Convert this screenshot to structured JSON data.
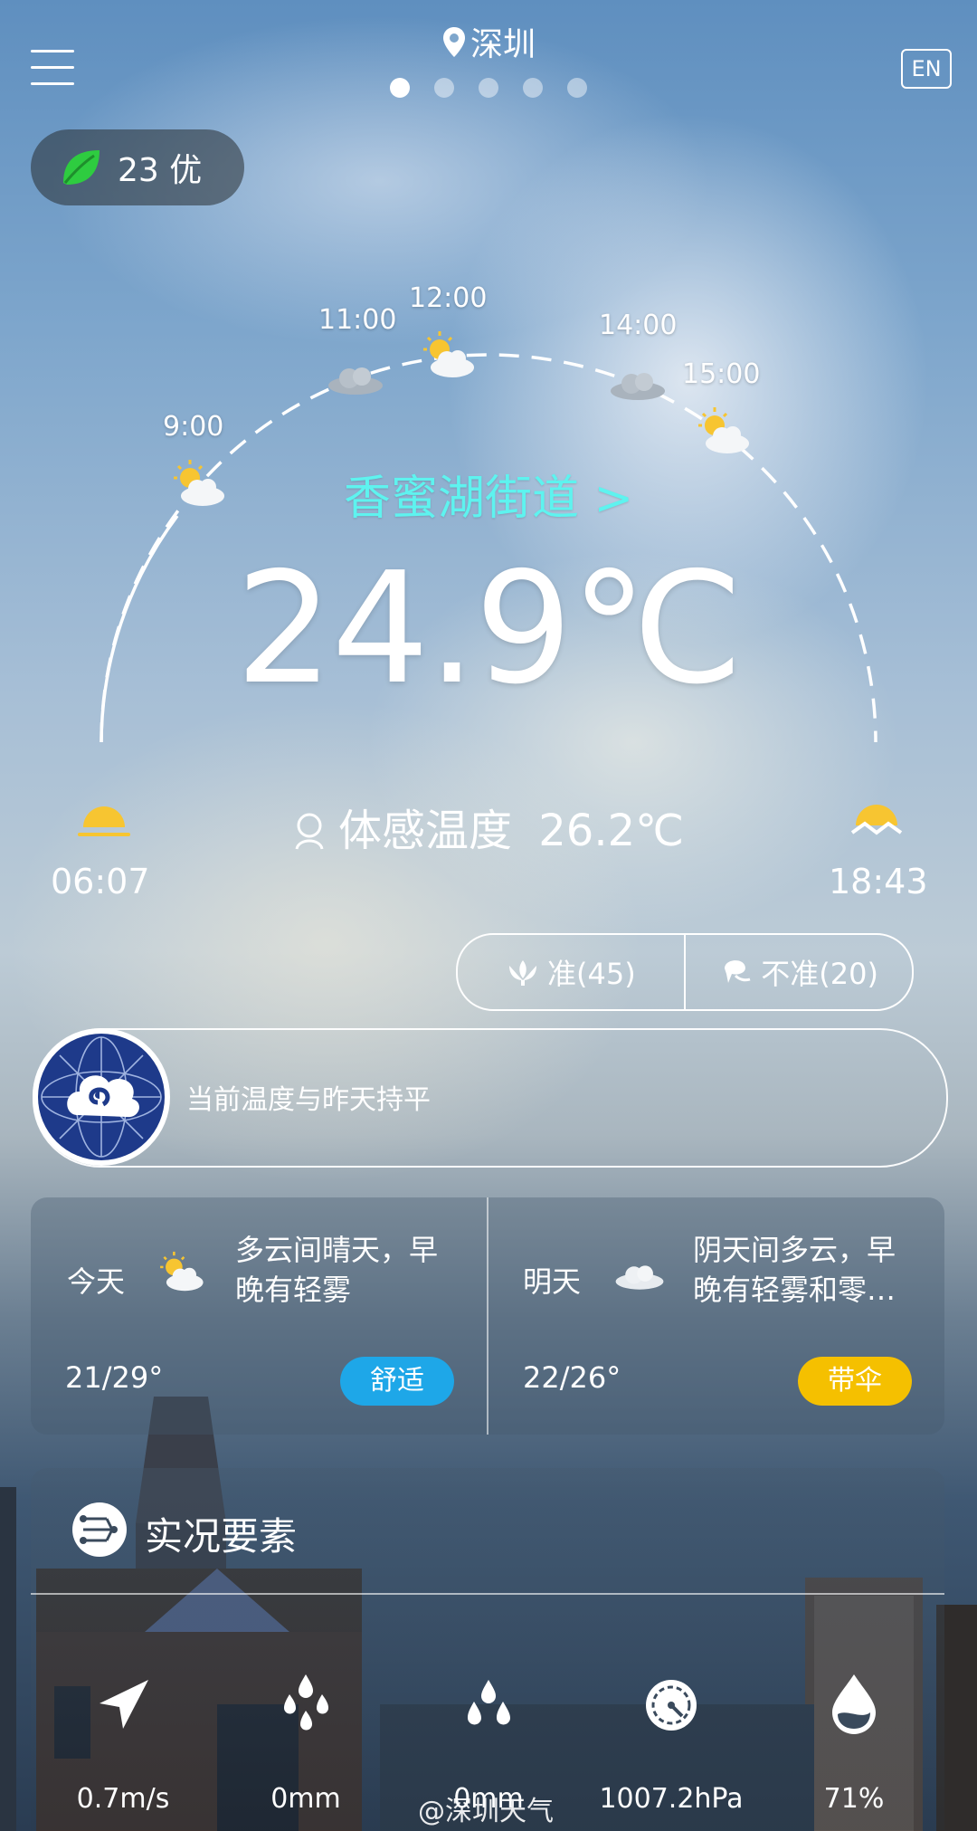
{
  "header": {
    "city": "深圳",
    "lang_button": "EN",
    "page_count": 5,
    "active_page": 0
  },
  "aqi": {
    "text": "23 优",
    "value": 23,
    "level": "优",
    "color": "#2ecc40"
  },
  "hourly": [
    {
      "time": "9:00",
      "icon": "partly-sunny-icon"
    },
    {
      "time": "11:00",
      "icon": "cloud-icon"
    },
    {
      "time": "12:00",
      "icon": "partly-sunny-icon"
    },
    {
      "time": "14:00",
      "icon": "cloud-icon"
    },
    {
      "time": "15:00",
      "icon": "partly-sunny-icon"
    }
  ],
  "current": {
    "district": "香蜜湖街道 >",
    "temperature": "24.9℃",
    "feels_like_label": "体感温度",
    "feels_like_value": "26.2℃",
    "sunrise": "06:07",
    "sunset": "18:43"
  },
  "vote": {
    "accurate": "准(45)",
    "inaccurate": "不准(20)"
  },
  "notice": {
    "text": "当前温度与昨天持平"
  },
  "forecast": {
    "today": {
      "label": "今天",
      "desc_line1": "多云间晴天，早",
      "desc_line2": "晚有轻雾",
      "temp": "21/29°",
      "badge": "舒适",
      "badge_color": "#1ea7e8",
      "icon": "partly-sunny-icon"
    },
    "tomorrow": {
      "label": "明天",
      "desc_line1": "阴天间多云，早",
      "desc_line2": "晚有轻雾和零…",
      "temp": "22/26°",
      "badge": "带伞",
      "badge_color": "#f5c000",
      "icon": "cloud-icon"
    }
  },
  "observations": {
    "title": "实况要素",
    "items": [
      {
        "icon": "wind-direction-icon",
        "value": "0.7m/s"
      },
      {
        "icon": "rain-icon",
        "value": "0mm"
      },
      {
        "icon": "rain-icon",
        "value": "0mm"
      },
      {
        "icon": "pressure-gauge-icon",
        "value": "1007.2hPa"
      },
      {
        "icon": "humidity-icon",
        "value": "71%"
      }
    ]
  },
  "watermark": "@深圳天气",
  "colors": {
    "district": "#5ef3ef",
    "accent_blue": "#1ea7e8",
    "accent_yellow": "#f5c000"
  }
}
